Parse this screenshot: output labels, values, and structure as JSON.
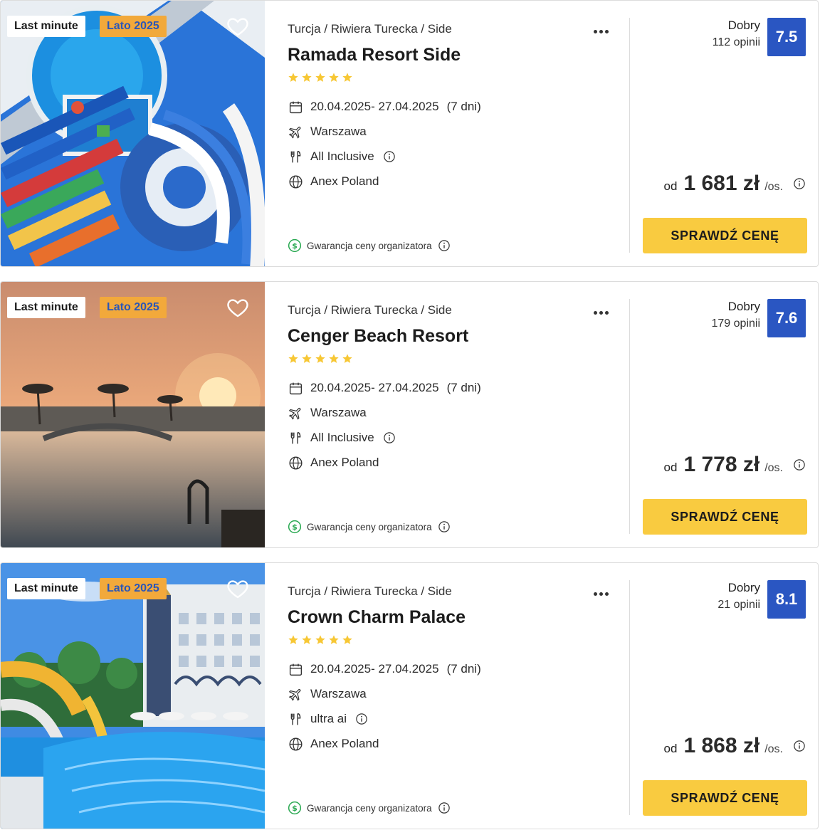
{
  "colors": {
    "accent_yellow": "#f9cb40",
    "score_blue": "#2a56c2",
    "season_badge": "#f2a93b",
    "season_text": "#2a56b8",
    "star": "#f7c734",
    "guarantee_green": "#2aa952"
  },
  "icons": {
    "favorite": "heart-outline-icon",
    "more": "more-dots-icon",
    "date": "calendar-icon",
    "departure": "plane-icon",
    "board": "cutlery-icon",
    "operator": "globe-icon",
    "info": "info-icon",
    "guarantee": "dollar-circle-icon",
    "star": "star-icon"
  },
  "offers": [
    {
      "photo": "water-park-aerial",
      "badges": {
        "last_minute": "Last minute",
        "season": "Lato 2025"
      },
      "breadcrumb": "Turcja / Riwiera Turecka / Side",
      "name": "Ramada Resort Side",
      "stars": 5,
      "dates": "20.04.2025- 27.04.2025",
      "duration": "(7 dni)",
      "departure": "Warszawa",
      "board": "All Inclusive",
      "operator": "Anex Poland",
      "guarantee": "Gwarancja ceny organizatora",
      "rating_word": "Dobry",
      "reviews": "112 opinii",
      "score": "7.5",
      "price_prefix": "od",
      "price": "1 681 zł",
      "price_unit": "/os.",
      "cta": "SPRAWDŹ CENĘ"
    },
    {
      "photo": "sunset-pool",
      "badges": {
        "last_minute": "Last minute",
        "season": "Lato 2025"
      },
      "breadcrumb": "Turcja / Riwiera Turecka / Side",
      "name": "Cenger Beach Resort",
      "stars": 5,
      "dates": "20.04.2025- 27.04.2025",
      "duration": "(7 dni)",
      "departure": "Warszawa",
      "board": "All Inclusive",
      "operator": "Anex Poland",
      "guarantee": "Gwarancja ceny organizatora",
      "rating_word": "Dobry",
      "reviews": "179 opinii",
      "score": "7.6",
      "price_prefix": "od",
      "price": "1 778 zł",
      "price_unit": "/os.",
      "cta": "SPRAWDŹ CENĘ"
    },
    {
      "photo": "palace-pool-slides",
      "badges": {
        "last_minute": "Last minute",
        "season": "Lato 2025"
      },
      "breadcrumb": "Turcja / Riwiera Turecka / Side",
      "name": "Crown Charm Palace",
      "stars": 5,
      "dates": "20.04.2025- 27.04.2025",
      "duration": "(7 dni)",
      "departure": "Warszawa",
      "board": "ultra ai",
      "operator": "Anex Poland",
      "guarantee": "Gwarancja ceny organizatora",
      "rating_word": "Dobry",
      "reviews": "21 opinii",
      "score": "8.1",
      "price_prefix": "od",
      "price": "1 868 zł",
      "price_unit": "/os.",
      "cta": "SPRAWDŹ CENĘ"
    }
  ]
}
